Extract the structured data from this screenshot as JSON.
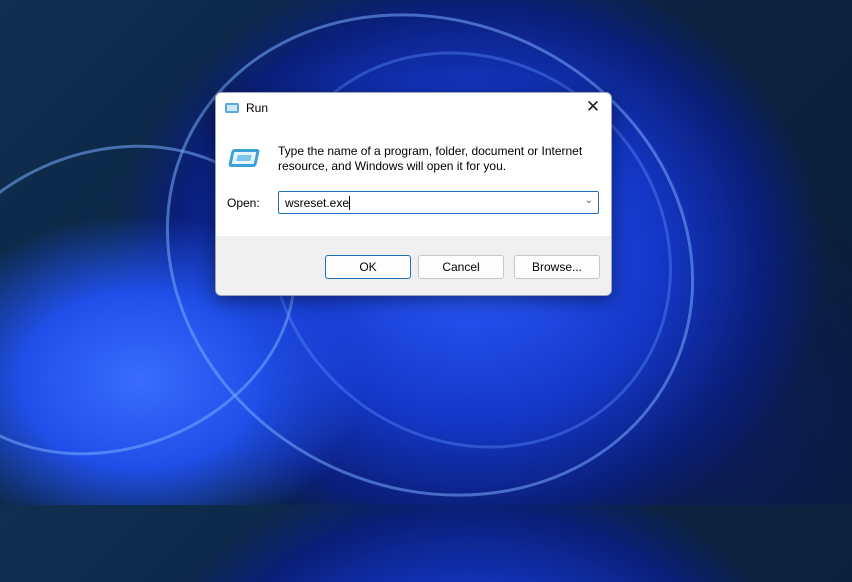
{
  "dialog": {
    "title": "Run",
    "close_label": "✕",
    "description": "Type the name of a program, folder, document or Internet resource, and Windows will open it for you.",
    "open_label": "Open:",
    "open_value": "wsreset.exe",
    "buttons": {
      "ok": "OK",
      "cancel": "Cancel",
      "browse": "Browse..."
    }
  },
  "colors": {
    "accent": "#1f6fb7",
    "footer": "#f0f0f0"
  }
}
